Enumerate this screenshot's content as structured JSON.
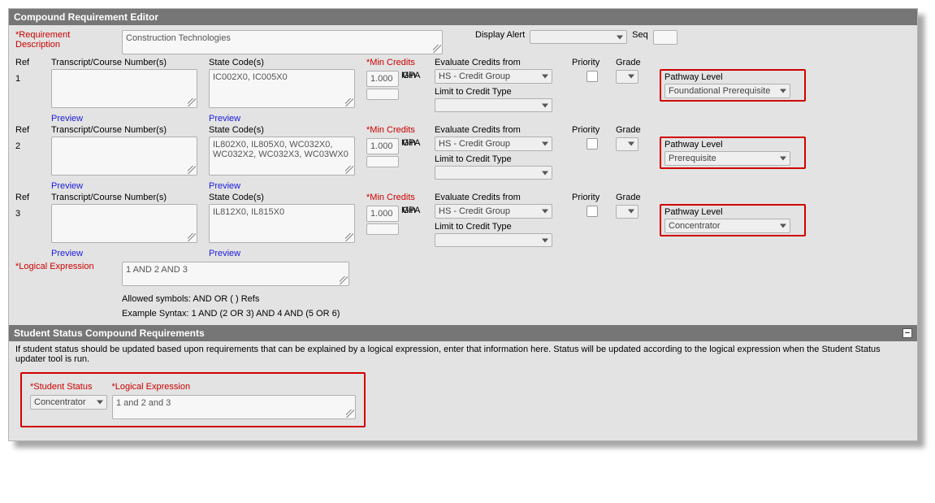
{
  "editor": {
    "title": "Compound Requirement Editor",
    "reqDescLabel": "*Requirement Description",
    "reqDesc": "Construction Technologies",
    "displayAlertLabel": "Display Alert",
    "displayAlertValue": "",
    "seqLabel": "Seq",
    "seqValue": "",
    "cols": {
      "ref": "Ref",
      "tc": "Transcript/Course Number(s)",
      "st": "State Code(s)",
      "mc": "*Min Credits",
      "ec": "Evaluate Credits from",
      "pr": "Priority",
      "gr": "Grade",
      "min": "Min",
      "gpa": "GPA",
      "lct": "Limit to Credit Type",
      "pl": "Pathway Level"
    },
    "rows": [
      {
        "ref": "1",
        "tc": "",
        "st": "IC002X0, IC005X0",
        "mc": "1.000",
        "gpa": "",
        "ec": "HS - Credit Group",
        "lct": "",
        "priority": false,
        "grade": "",
        "pathway": "Foundational Prerequisite"
      },
      {
        "ref": "2",
        "tc": "",
        "st": "IL802X0, IL805X0, WC032X0, WC032X2, WC032X3, WC03WX0",
        "mc": "1.000",
        "gpa": "",
        "ec": "HS - Credit Group",
        "lct": "",
        "priority": false,
        "grade": "",
        "pathway": "Prerequisite"
      },
      {
        "ref": "3",
        "tc": "",
        "st": "IL812X0, IL815X0",
        "mc": "1.000",
        "gpa": "",
        "ec": "HS - Credit Group",
        "lct": "",
        "priority": false,
        "grade": "",
        "pathway": "Concentrator"
      }
    ],
    "previewLabel": "Preview",
    "logicalExprLabel": "*Logical Expression",
    "logicalExpr": "1 AND 2 AND 3",
    "allowed": "Allowed symbols: AND OR ( ) Refs",
    "example": "Example Syntax: 1 AND (2 OR 3) AND 4 AND (5 OR 6)"
  },
  "status": {
    "title": "Student Status Compound Requirements",
    "desc": "If student status should be updated based upon requirements that can be explained by a logical expression, enter that information here. Status will be updated according to the logical expression when the Student Status updater tool is run.",
    "ssLabel": "*Student Status",
    "leLabel": "*Logical Expression",
    "ssValue": "Concentrator",
    "leValue": "1 and 2 and 3"
  }
}
